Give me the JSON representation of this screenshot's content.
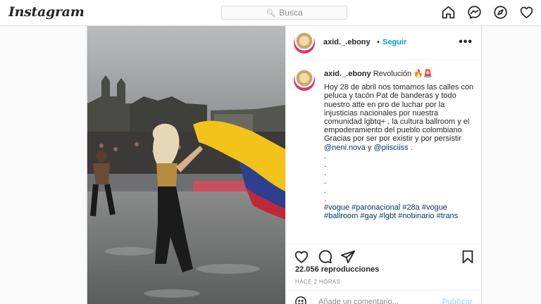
{
  "app": {
    "logo_text": "Instagram",
    "search_placeholder": "Busca"
  },
  "nav": {
    "icons": [
      "home-icon",
      "messenger-icon",
      "explore-compass-icon",
      "heart-icon"
    ]
  },
  "post": {
    "username": "axid._.ebony",
    "separator": "•",
    "follow_label": "Seguir",
    "more_label": "•••",
    "caption": {
      "username": "axid._.ebony",
      "headline": "Revolución 🔥🚨",
      "body_start": "Hoy 28 de abril nos tomamos las calles con peluca y tacón Pat de banderas y todo nuestro atte en pro de luchar por la injusticias nacionales por nuestra comunidad lgbtq+ , la cultura ballroom y el empoderamiento del pueblo colombiano Gracias por ser por existir y por persistir ",
      "mention_1": "@neni.nova",
      "connector": " y ",
      "mention_2": "@piisciiss",
      "body_end": " .",
      "dots": [
        ".",
        ".",
        ".",
        ".",
        ".",
        "."
      ],
      "hashtags": "#vogue #paronacional #28a #vogue #ballroom #gay #lgbt #nobinario #trans"
    },
    "caption_time": "2 h",
    "views": "22.056 reproducciones",
    "posted_ago": "HACE 2 HORAS",
    "comment_placeholder": "Añade un comentario...",
    "publish_label": "Publicar"
  },
  "colors": {
    "accent_blue": "#0095f6",
    "link_dark": "#00376b",
    "muted": "#8e8e8e",
    "border": "#dbdbdb"
  }
}
